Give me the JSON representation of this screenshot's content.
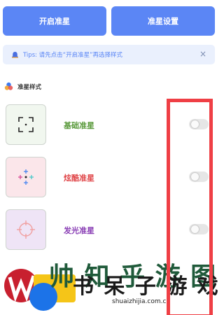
{
  "buttons": {
    "open_label": "开启准星",
    "settings_label": "准星设置"
  },
  "tip": {
    "text": "Tips: 请先点击“开启准星”再选择样式",
    "close": "×"
  },
  "section": {
    "title": "准星样式"
  },
  "styles": [
    {
      "label": "基础准星",
      "label_color": "#5a9a3c",
      "tile_bg": "#f1f7ef",
      "icon": "basic-crosshair-icon",
      "enabled": false
    },
    {
      "label": "炫酷准星",
      "label_color": "#e0484b",
      "tile_bg": "#fbe6ea",
      "icon": "cool-crosshair-icon",
      "enabled": false
    },
    {
      "label": "发光准星",
      "label_color": "#8a3fb5",
      "tile_bg": "#efe4f6",
      "icon": "glow-crosshair-icon",
      "enabled": false
    }
  ],
  "watermark": {
    "url": "shuaizhijia.com.cn"
  },
  "colors": {
    "accent": "#5b86f5",
    "highlight": "#ef3f45"
  }
}
